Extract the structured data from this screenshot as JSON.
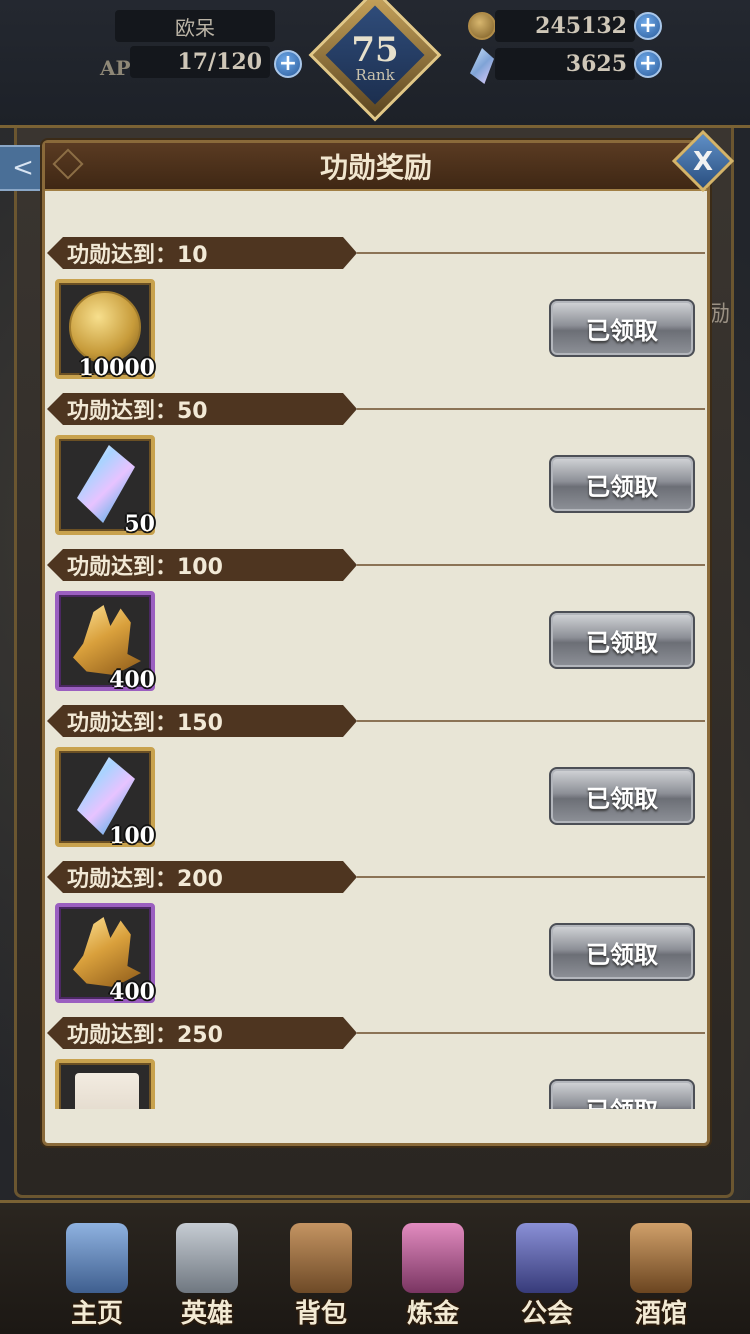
{
  "hud": {
    "player_name": "欧呆",
    "ap_label": "AP",
    "ap_value": "17/120",
    "rank_number": "75",
    "rank_label": "Rank",
    "gold_value": "245132",
    "gem_value": "3625",
    "plus_symbol": "+"
  },
  "background": {
    "side_tab_glyph": "<",
    "right_text": "励"
  },
  "modal": {
    "title": "功勋奖励",
    "close_glyph": "X",
    "rewards": [
      {
        "threshold": "功勋达到：10",
        "item_icon": "gold-coin-icon",
        "quantity": "10000",
        "frame": "gold",
        "button": "已领取"
      },
      {
        "threshold": "功勋达到：50",
        "item_icon": "rainbow-crystal-icon",
        "quantity": "50",
        "frame": "gold",
        "button": "已领取"
      },
      {
        "threshold": "功勋达到：100",
        "item_icon": "topaz-crystal-icon",
        "quantity": "400",
        "frame": "purple",
        "button": "已领取"
      },
      {
        "threshold": "功勋达到：150",
        "item_icon": "rainbow-crystal-icon",
        "quantity": "100",
        "frame": "gold",
        "button": "已领取"
      },
      {
        "threshold": "功勋达到：200",
        "item_icon": "topaz-crystal-icon",
        "quantity": "400",
        "frame": "purple",
        "button": "已领取"
      },
      {
        "threshold": "功勋达到：250",
        "item_icon": "scroll-icon",
        "quantity": "",
        "frame": "gold",
        "button": "已领取"
      }
    ]
  },
  "nav": {
    "items": [
      {
        "label": "主页",
        "icon": "castle-icon",
        "color": "#5f86c0"
      },
      {
        "label": "英雄",
        "icon": "hero-helmet-icon",
        "color": "#9aa3ad"
      },
      {
        "label": "背包",
        "icon": "backpack-icon",
        "color": "#9c7042"
      },
      {
        "label": "炼金",
        "icon": "potion-icon",
        "color": "#b05a8f"
      },
      {
        "label": "公会",
        "icon": "guild-shield-icon",
        "color": "#5a5fa8"
      },
      {
        "label": "酒馆",
        "icon": "tavern-barrel-icon",
        "color": "#a2723f"
      }
    ]
  }
}
